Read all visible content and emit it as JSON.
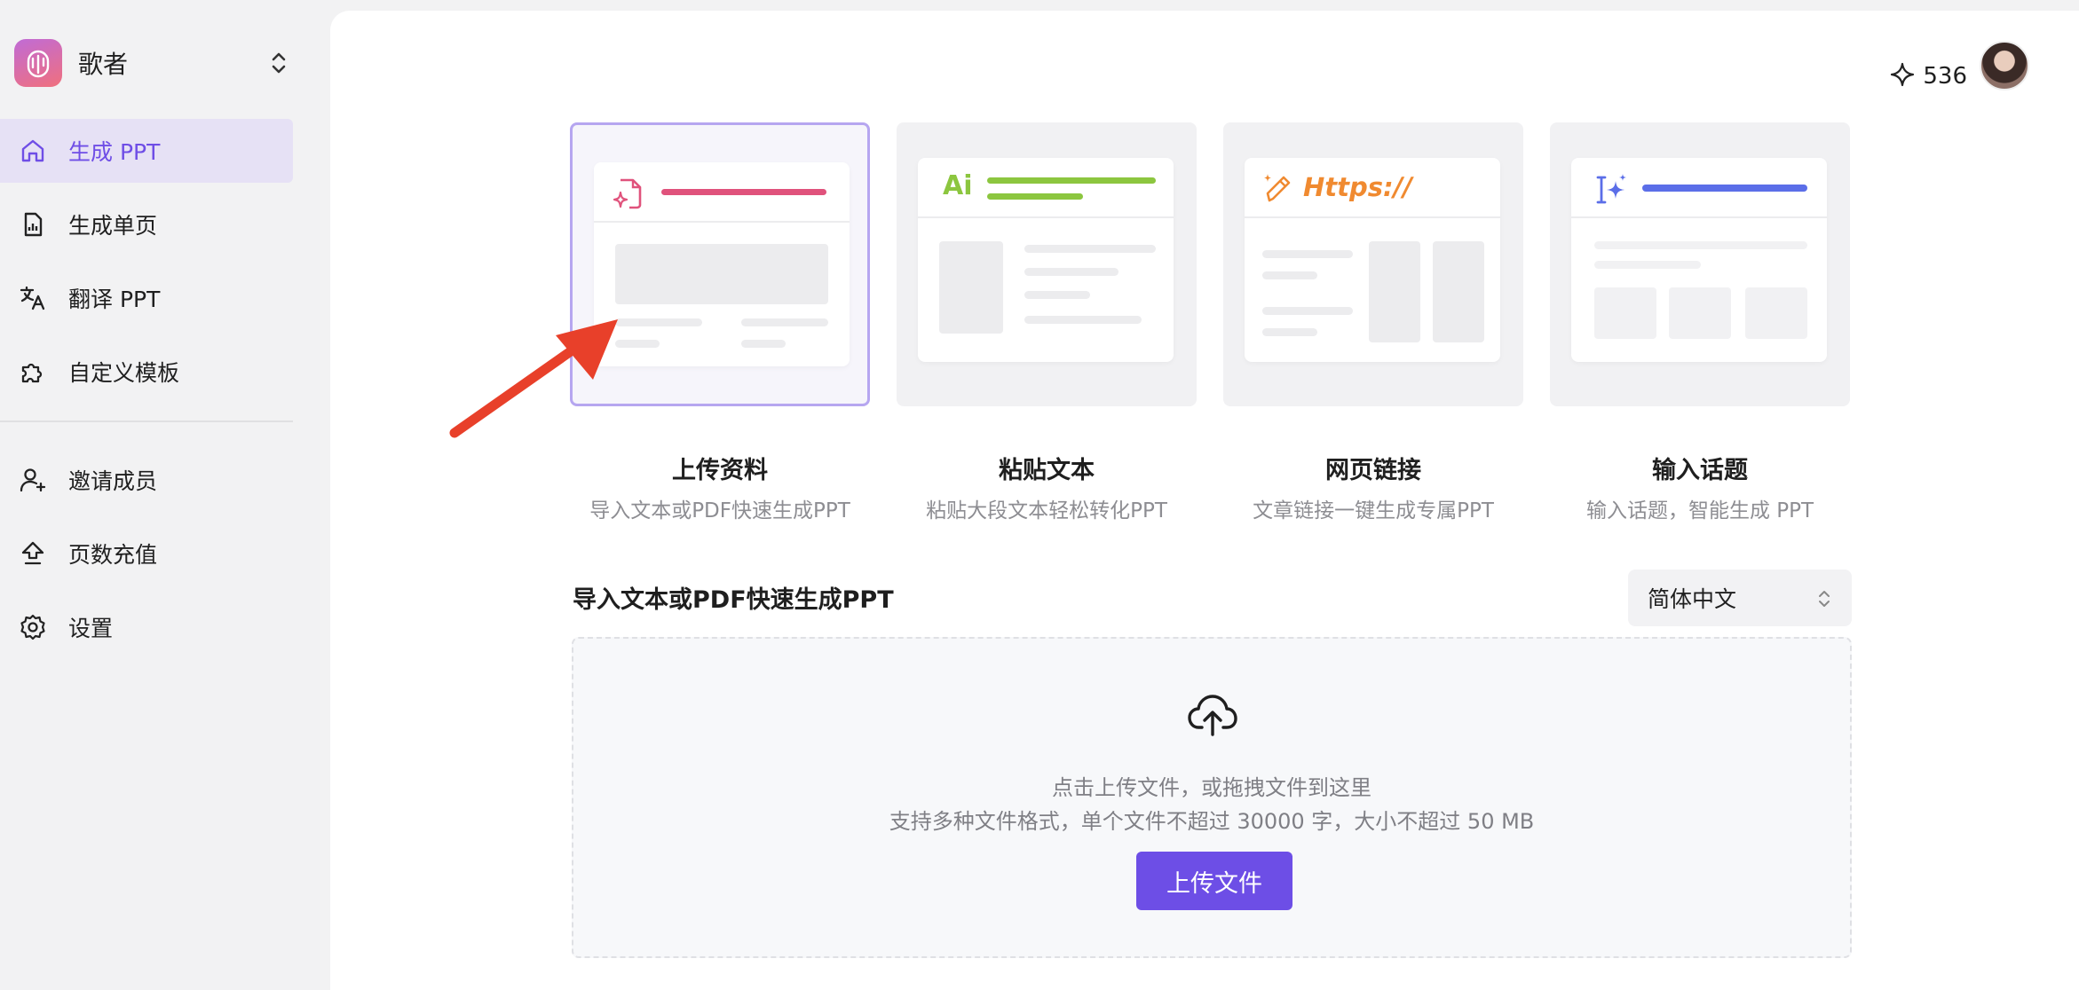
{
  "workspace": {
    "name": "歌者"
  },
  "nav": {
    "items": [
      {
        "label": "生成 PPT",
        "icon": "home-icon",
        "active": true
      },
      {
        "label": "生成单页",
        "icon": "file-chart-icon"
      },
      {
        "label": "翻译 PPT",
        "icon": "translate-icon"
      },
      {
        "label": "自定义模板",
        "icon": "puzzle-icon"
      }
    ],
    "secondary": [
      {
        "label": "邀请成员",
        "icon": "user-plus-icon"
      },
      {
        "label": "页数充值",
        "icon": "upload-arrow-icon"
      },
      {
        "label": "设置",
        "icon": "gear-icon"
      }
    ]
  },
  "header": {
    "credits": "536"
  },
  "modes": [
    {
      "title": "上传资料",
      "subtitle": "导入文本或PDF快速生成PPT",
      "icon": "file-sparkle-icon",
      "selected": true
    },
    {
      "title": "粘贴文本",
      "subtitle": "粘贴大段文本轻松转化PPT",
      "icon": "ai-text-icon",
      "badge": "Ai"
    },
    {
      "title": "网页链接",
      "subtitle": "文章链接一键生成专属PPT",
      "icon": "magic-pen-icon",
      "badge": "Https://"
    },
    {
      "title": "输入话题",
      "subtitle": "输入话题，智能生成 PPT",
      "icon": "cursor-sparkle-icon"
    }
  ],
  "section": {
    "title": "导入文本或PDF快速生成PPT"
  },
  "language_select": {
    "value": "简体中文"
  },
  "dropzone": {
    "line1": "点击上传文件，或拖拽文件到这里",
    "line2": "支持多种文件格式，单个文件不超过 30000 字，大小不超过 50 MB",
    "button": "上传文件"
  },
  "colors": {
    "accent": "#6d4ee6",
    "active_bg": "#e6e1f5",
    "card1_bar": "#e0527c",
    "card2_bar": "#8cc63f",
    "card3_text": "#f08a30",
    "card4_bar": "#5b6ee8",
    "arrow": "#e8402a"
  }
}
